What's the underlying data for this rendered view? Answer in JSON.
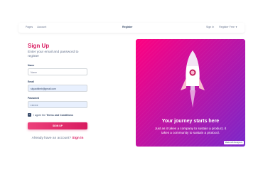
{
  "nav": {
    "links_left": [
      "Pages",
      "Account"
    ],
    "brand": "Register",
    "sign_in": "Sign In",
    "register_free": "Register Free"
  },
  "form": {
    "title": "Sign Up",
    "subtitle": "Enter your email and password to register",
    "name_label": "Name",
    "name_placeholder": "Name",
    "email_label": "Email",
    "email_value": "skyaoblimb@gmail.com",
    "password_label": "Password",
    "password_value": "••••••",
    "terms_prefix": "I agree the",
    "terms_link": "Terms and Conditions",
    "terms_checked": true,
    "submit_label": "SIGN UP",
    "already_text": "Already have an account?",
    "signin_link": "Sign in"
  },
  "panel": {
    "title": "Your journey starts here",
    "text": "Just as it takes a company to sustain a product, it takes a community to sustain a protocol.",
    "badge": "Made with Designers"
  },
  "colors": {
    "accent": "#d81b60",
    "panel_gradient_start": "#ff0080",
    "panel_gradient_end": "#7928ca",
    "text": "#344767"
  }
}
